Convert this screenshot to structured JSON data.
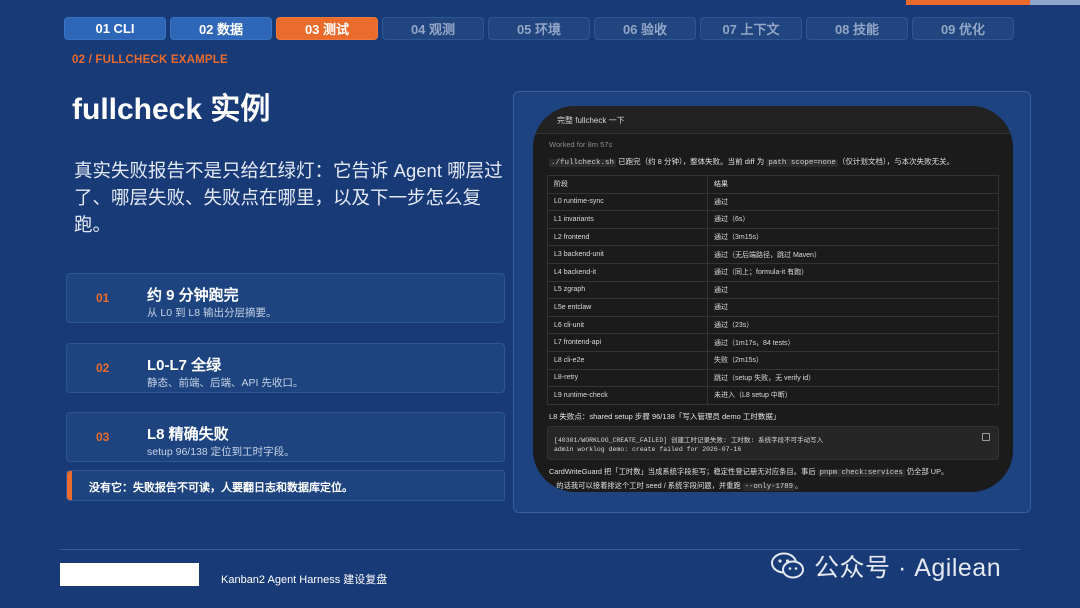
{
  "tabs": [
    {
      "label": "01 CLI"
    },
    {
      "label": "02 数据"
    },
    {
      "label": "03 测试"
    },
    {
      "label": "04 观测"
    },
    {
      "label": "05 环境"
    },
    {
      "label": "06 验收"
    },
    {
      "label": "07 上下文"
    },
    {
      "label": "08 技能"
    },
    {
      "label": "09 优化"
    }
  ],
  "active_tab": "03 测试",
  "section_label": "02 / FULLCHECK EXAMPLE",
  "title": "fullcheck 实例",
  "lead": "真实失败报告不是只给红绿灯：它告诉 Agent 哪层过了、哪层失败、失败点在哪里，以及下一步怎么复跑。",
  "cards": [
    {
      "num": "01",
      "title": "约 9 分钟跑完",
      "desc": "从 L0 到 L8 输出分层摘要。"
    },
    {
      "num": "02",
      "title": "L0-L7 全绿",
      "desc": "静态、前端、后端、API 先收口。"
    },
    {
      "num": "03",
      "title": "L8 精确失败",
      "desc": "setup 96/138 定位到工时字段。"
    }
  ],
  "callout": "没有它：失败报告不可读，人要翻日志和数据库定位。",
  "screenshot": {
    "header": "完整 fullcheck 一下",
    "worked": "Worked for 8m 57s",
    "summary_cmd": "./fullcheck.sh",
    "summary_a": " 已跑完（约 8 分钟），整体失败。当前 diff 为 ",
    "summary_code": "path scope=none",
    "summary_b": "（仅计划文档），与本次失败无关。",
    "table_headers": [
      "阶段",
      "结果"
    ],
    "rows": [
      [
        "L0 runtime-sync",
        "通过"
      ],
      [
        "L1 invariants",
        "通过（6s）"
      ],
      [
        "L2 frontend",
        "通过（3m15s）"
      ],
      [
        "L3 backend-unit",
        "通过（无后端路径，跳过 Maven）"
      ],
      [
        "L4 backend-it",
        "通过（同上；formula-it 有跑）"
      ],
      [
        "L5 zgraph",
        "通过"
      ],
      [
        "L5e entclaw",
        "通过"
      ],
      [
        "L6 cli-unit",
        "通过（23s）"
      ],
      [
        "L7 frontend-api",
        "通过（1m17s，84 tests）"
      ],
      [
        "L8 cli-e2e",
        "失败（2m15s）"
      ],
      [
        "L8-retry",
        "跳过（setup 失败，无 verify id）"
      ],
      [
        "L9 runtime-check",
        "未进入（L8 setup 中断）"
      ]
    ],
    "fail_point": "L8 失败点：shared setup 步骤 96/138「写入管理员 demo 工时数据」",
    "err_line1": "[40301/WORKLOG_CREATE_FAILED] 创建工时记录失败: 工时数: 系统字段不可手动写入",
    "err_line2": "admin worklog demo: create failed for 2026-07-16",
    "note1_a": "CardWriteGuard 把「工时数」当成系统字段拒写；稳定性登记册无对应条目。事后 ",
    "note1_code": "pnpm check:services",
    "note1_b": " 仍全部 UP。",
    "note2_a": "…的话我可以接着排这个工时 seed / 系统字段问题，并重跑 ",
    "note2_code": "--only-1789",
    "note2_b": "。"
  },
  "footer": "Kanban2 Agent Harness 建设复盘",
  "watermark": "公众号 · Agilean",
  "colors": {
    "background": "#183a76",
    "accent": "#ea6b2c",
    "tab_done": "#2f67b8"
  }
}
